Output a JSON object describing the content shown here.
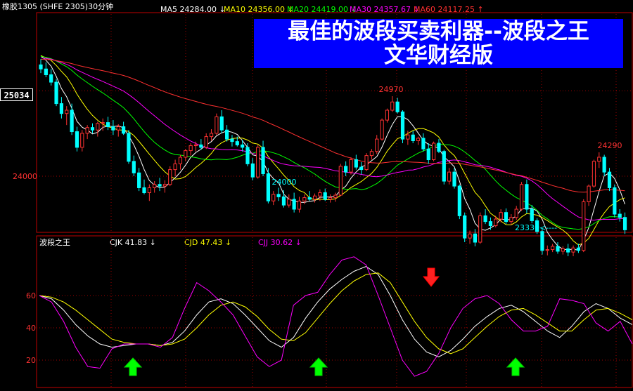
{
  "header": {
    "symbol": "橡胶1305 (SHFE 2305)30分钟",
    "ma": [
      {
        "label": "MA5",
        "value": "24284.00",
        "arrow": "↓",
        "color": "#ffffff"
      },
      {
        "label": "MA10",
        "value": "24356.00",
        "arrow": "↓",
        "color": "#ffff00"
      },
      {
        "label": "MA20",
        "value": "24419.00",
        "arrow": "↓",
        "color": "#00ff00"
      },
      {
        "label": "MA30",
        "value": "24357.67",
        "arrow": "↓",
        "color": "#ff00ff"
      },
      {
        "label": "MA60",
        "value": "24117.25",
        "arrow": "↑",
        "color": "#ff3030"
      }
    ]
  },
  "banner": {
    "line1": "最佳的波段买卖利器--波段之王",
    "line2": "文华财经版"
  },
  "price_box": "25034",
  "indicator_header": {
    "name": "波段之王",
    "items": [
      {
        "label": "CJK",
        "value": "41.83",
        "arrow": "↓",
        "color": "#ffffff"
      },
      {
        "label": "CJD",
        "value": "47.43",
        "arrow": "↓",
        "color": "#ffff00"
      },
      {
        "label": "CJJ",
        "value": "30.62",
        "arrow": "↓",
        "color": "#ff00ff"
      }
    ]
  },
  "colors": {
    "up": "#ff3232",
    "down": "#00ffff",
    "grid": "#a00000",
    "frame": "#c00000",
    "axis_text": "#ff3232"
  },
  "chart_data": [
    {
      "type": "candlestick",
      "title": "橡胶1305 (SHFE 2305)30分钟",
      "y_ticks": [
        24000
      ],
      "highlighted_price": 25034,
      "annotations": [
        {
          "text": "24970",
          "kind": "high"
        },
        {
          "text": "24000",
          "kind": "low"
        },
        {
          "text": "24290",
          "kind": "high"
        },
        {
          "text": "23330<----",
          "kind": "low"
        }
      ],
      "moving_averages": [
        "MA5",
        "MA10",
        "MA20",
        "MA30",
        "MA60"
      ],
      "ohlc": [
        [
          25350,
          25420,
          25250,
          25300
        ],
        [
          25300,
          25380,
          25200,
          25230
        ],
        [
          25230,
          25300,
          25100,
          25140
        ],
        [
          25140,
          25180,
          24850,
          24880
        ],
        [
          24880,
          24960,
          24700,
          24760
        ],
        [
          24760,
          24850,
          24620,
          24800
        ],
        [
          24800,
          24880,
          24500,
          24540
        ],
        [
          24540,
          24600,
          24300,
          24350
        ],
        [
          24350,
          24560,
          24300,
          24520
        ],
        [
          24520,
          24620,
          24450,
          24590
        ],
        [
          24590,
          24640,
          24520,
          24560
        ],
        [
          24560,
          24660,
          24480,
          24640
        ],
        [
          24640,
          24700,
          24550,
          24650
        ],
        [
          24650,
          24720,
          24560,
          24600
        ],
        [
          24600,
          24680,
          24500,
          24560
        ],
        [
          24560,
          24630,
          24480,
          24600
        ],
        [
          24600,
          24660,
          24500,
          24520
        ],
        [
          24520,
          24560,
          24150,
          24180
        ],
        [
          24180,
          24250,
          24000,
          24040
        ],
        [
          24040,
          24100,
          23820,
          23860
        ],
        [
          23860,
          23960,
          23780,
          23800
        ],
        [
          23800,
          23900,
          23700,
          23860
        ],
        [
          23860,
          23940,
          23800,
          23900
        ],
        [
          23900,
          23980,
          23820,
          23880
        ],
        [
          23880,
          23950,
          23800,
          23900
        ],
        [
          23900,
          24120,
          23880,
          24080
        ],
        [
          24080,
          24200,
          24000,
          24150
        ],
        [
          24150,
          24260,
          24080,
          24230
        ],
        [
          24230,
          24330,
          24180,
          24310
        ],
        [
          24310,
          24400,
          24250,
          24370
        ],
        [
          24370,
          24420,
          24300,
          24380
        ],
        [
          24380,
          24450,
          24320,
          24350
        ],
        [
          24350,
          24520,
          24330,
          24480
        ],
        [
          24480,
          24570,
          24430,
          24520
        ],
        [
          24520,
          24760,
          24500,
          24720
        ],
        [
          24720,
          24800,
          24520,
          24560
        ],
        [
          24560,
          24620,
          24420,
          24450
        ],
        [
          24450,
          24500,
          24360,
          24420
        ],
        [
          24420,
          24480,
          24360,
          24380
        ],
        [
          24380,
          24440,
          24300,
          24350
        ],
        [
          24350,
          24400,
          24120,
          24150
        ],
        [
          24150,
          24220,
          23950,
          23990
        ],
        [
          23990,
          24380,
          23970,
          24350
        ],
        [
          24350,
          24430,
          24000,
          24030
        ],
        [
          24030,
          24100,
          23670,
          23700
        ],
        [
          23700,
          23820,
          23650,
          23780
        ],
        [
          23780,
          23860,
          23700,
          23750
        ],
        [
          23750,
          23830,
          23620,
          23650
        ],
        [
          23650,
          23780,
          23620,
          23720
        ],
        [
          23720,
          23800,
          23560,
          23600
        ],
        [
          23600,
          23750,
          23560,
          23700
        ],
        [
          23700,
          23780,
          23660,
          23740
        ],
        [
          23740,
          23820,
          23700,
          23720
        ],
        [
          23720,
          23790,
          23680,
          23760
        ],
        [
          23760,
          23840,
          23700,
          23800
        ],
        [
          23800,
          23850,
          23700,
          23720
        ],
        [
          23720,
          23780,
          23680,
          23740
        ],
        [
          23740,
          23800,
          23690,
          23770
        ],
        [
          23770,
          24150,
          23760,
          24120
        ],
        [
          24120,
          24180,
          24000,
          24050
        ],
        [
          24050,
          24230,
          24020,
          24200
        ],
        [
          24200,
          24260,
          24080,
          24110
        ],
        [
          24110,
          24170,
          24020,
          24080
        ],
        [
          24080,
          24280,
          24060,
          24250
        ],
        [
          24250,
          24330,
          24200,
          24300
        ],
        [
          24300,
          24500,
          24270,
          24450
        ],
        [
          24450,
          24700,
          24430,
          24680
        ],
        [
          24680,
          24820,
          24650,
          24800
        ],
        [
          24800,
          24970,
          24780,
          24900
        ],
        [
          24900,
          24950,
          24760,
          24780
        ],
        [
          24780,
          24800,
          24400,
          24450
        ],
        [
          24450,
          24550,
          24380,
          24500
        ],
        [
          24500,
          24550,
          24400,
          24430
        ],
        [
          24430,
          24480,
          24380,
          24460
        ],
        [
          24460,
          24520,
          24300,
          24330
        ],
        [
          24330,
          24400,
          24150,
          24200
        ],
        [
          24200,
          24420,
          24180,
          24400
        ],
        [
          24400,
          24450,
          24280,
          24300
        ],
        [
          24300,
          24320,
          23900,
          23940
        ],
        [
          23940,
          24100,
          23900,
          24050
        ],
        [
          24050,
          24100,
          23850,
          23880
        ],
        [
          23880,
          23900,
          23480,
          23520
        ],
        [
          23520,
          23560,
          23200,
          23250
        ],
        [
          23250,
          23340,
          23180,
          23300
        ],
        [
          23300,
          23360,
          23150,
          23200
        ],
        [
          23200,
          23560,
          23180,
          23520
        ],
        [
          23520,
          23600,
          23420,
          23450
        ],
        [
          23450,
          23500,
          23350,
          23400
        ],
        [
          23400,
          23520,
          23380,
          23480
        ],
        [
          23480,
          23600,
          23440,
          23560
        ],
        [
          23560,
          23610,
          23420,
          23450
        ],
        [
          23450,
          23540,
          23410,
          23500
        ],
        [
          23500,
          23640,
          23470,
          23600
        ],
        [
          23600,
          23930,
          23580,
          23900
        ],
        [
          23900,
          23960,
          23550,
          23600
        ],
        [
          23600,
          23650,
          23430,
          23460
        ],
        [
          23460,
          23490,
          23300,
          23330
        ],
        [
          23330,
          23360,
          23050,
          23100
        ],
        [
          23100,
          23160,
          23040,
          23110
        ],
        [
          23110,
          23180,
          23080,
          23150
        ],
        [
          23150,
          23200,
          23060,
          23090
        ],
        [
          23090,
          23150,
          23050,
          23120
        ],
        [
          23120,
          23180,
          23030,
          23080
        ],
        [
          23080,
          23160,
          23030,
          23130
        ],
        [
          23130,
          23180,
          23070,
          23100
        ],
        [
          23100,
          23720,
          23080,
          23690
        ],
        [
          23690,
          23900,
          23640,
          23880
        ],
        [
          23880,
          24200,
          23860,
          24180
        ],
        [
          24180,
          24290,
          24100,
          24230
        ],
        [
          24230,
          24260,
          24000,
          24050
        ],
        [
          24050,
          24100,
          23820,
          23860
        ],
        [
          23860,
          23900,
          23500,
          23540
        ],
        [
          23540,
          23600,
          23450,
          23500
        ],
        [
          23500,
          23560,
          23300,
          23350
        ]
      ]
    },
    {
      "type": "line",
      "title": "波段之王",
      "y_ticks": [
        20,
        40,
        60
      ],
      "signals": {
        "up": 3,
        "down": 1
      },
      "series": [
        {
          "name": "CJK",
          "color": "#ffffff",
          "values": [
            60,
            58,
            51,
            42,
            35,
            30,
            28,
            29,
            30,
            30,
            29,
            31,
            38,
            48,
            56,
            58,
            55,
            48,
            40,
            32,
            28,
            34,
            46,
            56,
            64,
            70,
            75,
            78,
            73,
            60,
            45,
            33,
            25,
            22,
            26,
            33,
            41,
            47,
            52,
            54,
            50,
            44,
            38,
            34,
            41,
            50,
            55,
            52,
            46,
            42
          ]
        },
        {
          "name": "CJD",
          "color": "#ffff00",
          "values": [
            60,
            59,
            56,
            51,
            45,
            39,
            33,
            31,
            30,
            30,
            29,
            30,
            33,
            40,
            48,
            54,
            56,
            53,
            47,
            39,
            33,
            32,
            37,
            46,
            55,
            63,
            69,
            73,
            74,
            68,
            56,
            44,
            34,
            27,
            24,
            27,
            34,
            41,
            47,
            51,
            52,
            48,
            43,
            38,
            38,
            45,
            51,
            52,
            49,
            45
          ]
        },
        {
          "name": "CJJ",
          "color": "#ff00ff",
          "values": [
            60,
            56,
            44,
            28,
            16,
            15,
            27,
            30,
            30,
            30,
            28,
            34,
            52,
            68,
            63,
            56,
            48,
            35,
            22,
            16,
            20,
            54,
            60,
            62,
            73,
            82,
            84,
            79,
            60,
            40,
            20,
            10,
            13,
            24,
            40,
            52,
            58,
            60,
            55,
            45,
            38,
            38,
            41,
            58,
            57,
            55,
            43,
            38,
            44,
            30
          ]
        }
      ]
    }
  ]
}
